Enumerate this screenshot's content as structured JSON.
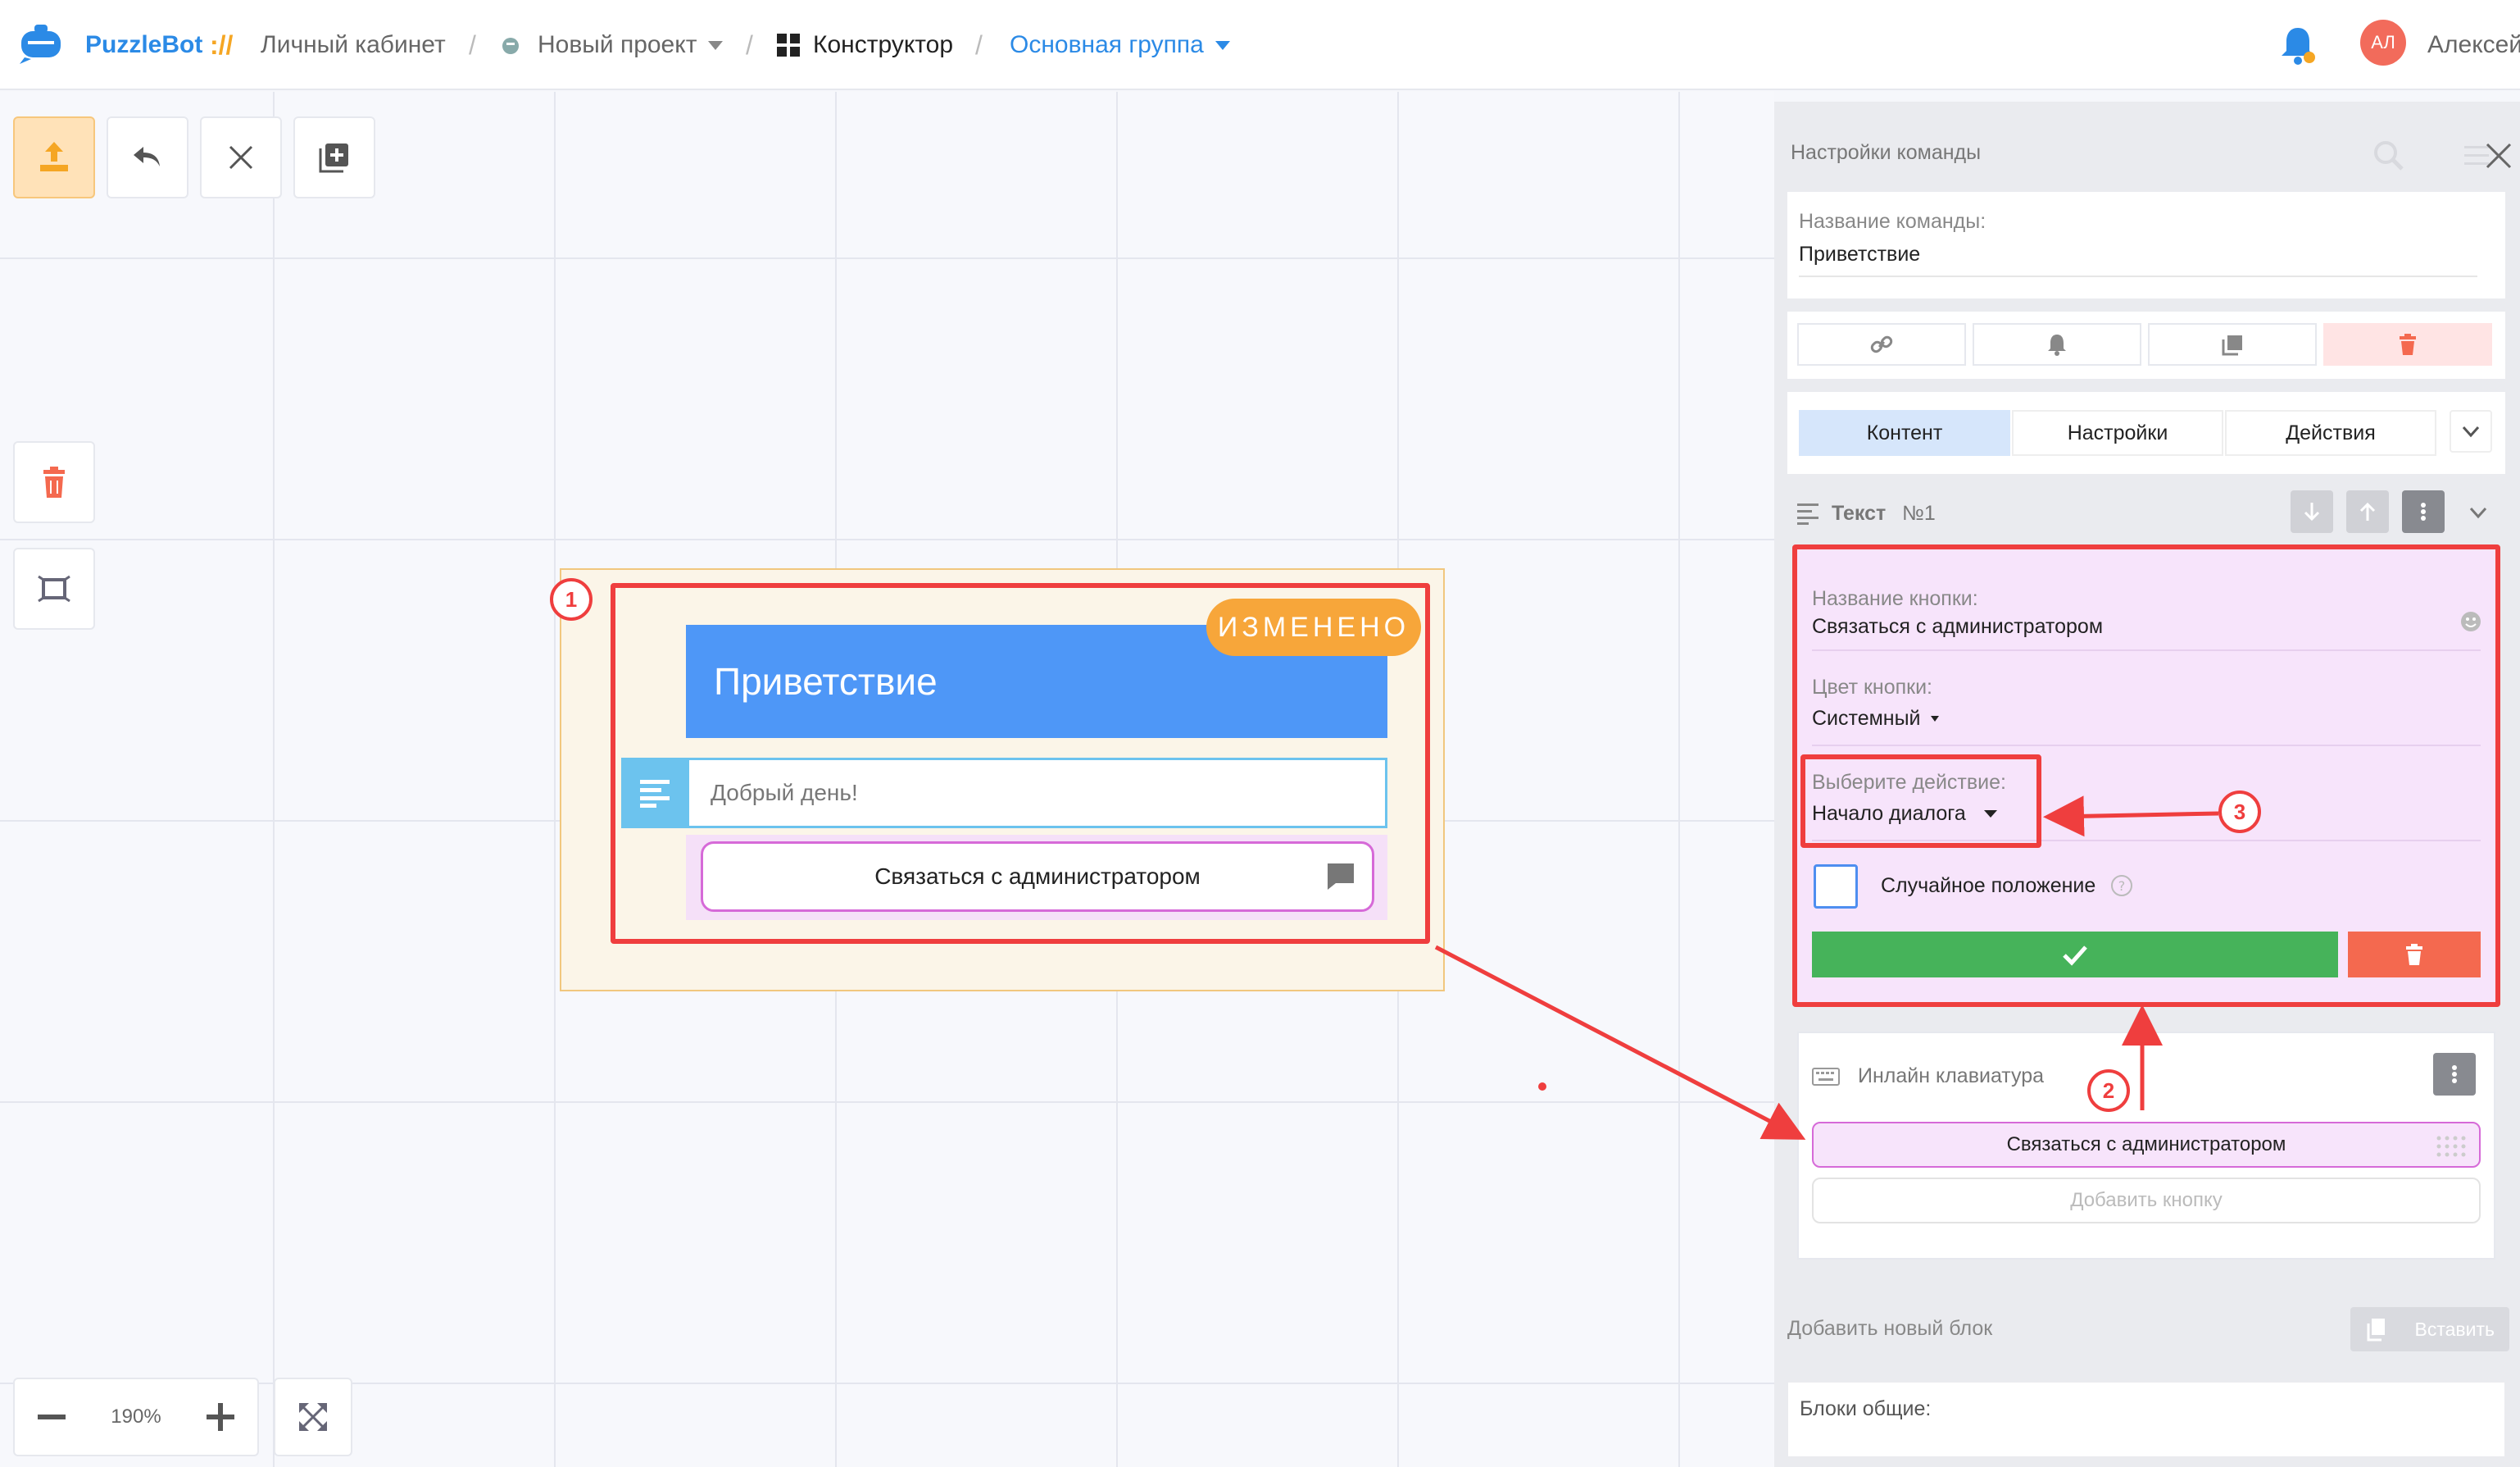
{
  "topbar": {
    "brand": "PuzzleBot",
    "brand_sep": "://",
    "crumbs": {
      "cabinet": "Личный кабинет",
      "project": "Новый проект",
      "constructor": "Конструктор",
      "group": "Основная группа"
    },
    "sep": "/",
    "avatar_initials": "АЛ",
    "user_name": "Алексей"
  },
  "canvas": {
    "zoom": "190%",
    "node": {
      "title": "Приветствие",
      "changed_badge": "ИЗМЕНЕНО",
      "text_value": "Добрый день!",
      "button_label": "Связаться с администратором"
    }
  },
  "annotations": {
    "one": "1",
    "two": "2",
    "three": "3"
  },
  "panel": {
    "title": "Настройки команды",
    "command_name_label": "Название команды:",
    "command_name_value": "Приветствие",
    "tabs": [
      "Контент",
      "Настройки",
      "Действия"
    ],
    "block_title": "Текст",
    "block_number": "№1",
    "edit": {
      "button_name_label": "Название кнопки:",
      "button_name_value": "Связаться с администратором",
      "button_color_label": "Цвет кнопки:",
      "button_color_value": "Системный",
      "action_label": "Выберите действие:",
      "action_value": "Начало диалога",
      "random_position_label": "Случайное положение"
    },
    "keyboard": {
      "title": "Инлайн клавиатура",
      "button_label": "Связаться с администратором",
      "add_button": "Добавить кнопку"
    },
    "add_block_label": "Добавить новый блок",
    "paste_label": "Вставить",
    "common_blocks_label": "Блоки общие:"
  },
  "colors": {
    "brand_blue": "#2b8ae6",
    "accent_orange": "#f7a63a",
    "annotation_red": "#ef3e3e",
    "save_green": "#46b35a",
    "delete_red": "#f4694f"
  }
}
